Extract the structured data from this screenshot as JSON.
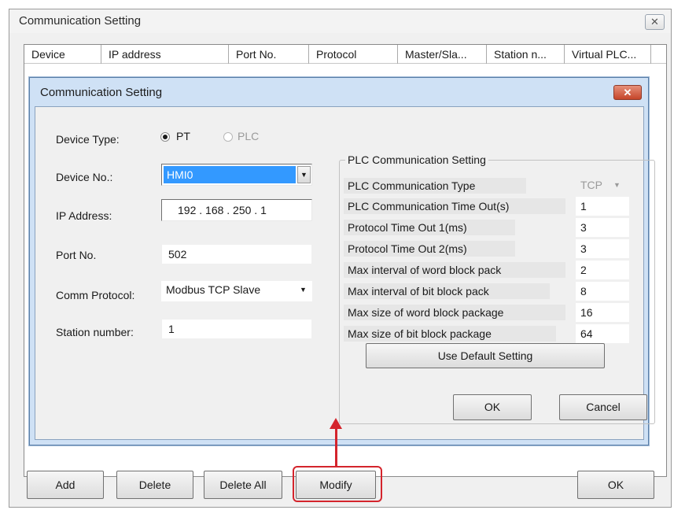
{
  "outer_dialog": {
    "title": "Communication Setting",
    "close_glyph": "✕",
    "table_columns": [
      "Device",
      "IP address",
      "Port No.",
      "Protocol",
      "Master/Sla...",
      "Station n...",
      "Virtual PLC..."
    ],
    "buttons": {
      "add": "Add",
      "delete": "Delete",
      "delete_all": "Delete All",
      "modify": "Modify",
      "ok": "OK"
    }
  },
  "inner_dialog": {
    "title": "Communication Setting",
    "close_glyph": "✕",
    "device_type": {
      "label": "Device Type:",
      "options": [
        "PT",
        "PLC"
      ],
      "selected": "PT"
    },
    "device_no": {
      "label": "Device No.:",
      "value": "HMI0"
    },
    "ip_address": {
      "label": "IP Address:",
      "value": "192 . 168 . 250 .  1"
    },
    "port_no": {
      "label": "Port No.",
      "value": "502"
    },
    "comm_protocol": {
      "label": "Comm Protocol:",
      "value": "Modbus TCP Slave"
    },
    "station_number": {
      "label": "Station number:",
      "value": "1"
    },
    "plc_group": {
      "title": "PLC Communication Setting",
      "rows": [
        {
          "label": "PLC Communication Type",
          "value": "TCP"
        },
        {
          "label": "PLC Communication Time Out(s)",
          "value": "1"
        },
        {
          "label": "Protocol Time Out 1(ms)",
          "value": "3"
        },
        {
          "label": "Protocol Time Out 2(ms)",
          "value": "3"
        },
        {
          "label": "Max interval of word block pack",
          "value": "2"
        },
        {
          "label": "Max interval of bit block pack",
          "value": "8"
        },
        {
          "label": "Max size of word block package",
          "value": "16"
        },
        {
          "label": "Max size of bit block package",
          "value": "64"
        }
      ],
      "default_button": "Use Default Setting"
    },
    "buttons": {
      "ok": "OK",
      "cancel": "Cancel"
    }
  },
  "colors": {
    "highlight": "#d4242c",
    "inner_frame": "#cfe1f5",
    "selection": "#3399ff"
  }
}
